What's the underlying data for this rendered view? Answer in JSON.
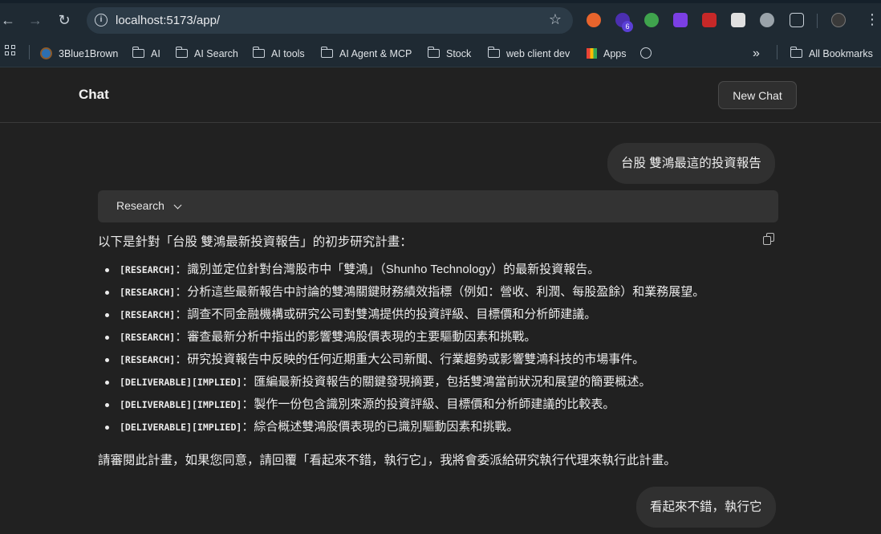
{
  "browser": {
    "url": "localhost:5173/app/",
    "extension_badge": "6",
    "bookmarks": [
      "3Blue1Brown",
      "AI",
      "AI Search",
      "AI tools",
      "AI Agent & MCP",
      "Stock",
      "web client dev",
      "Apps"
    ],
    "all_bookmarks": "All Bookmarks",
    "overflow": "»"
  },
  "app": {
    "title": "Chat",
    "new_chat_label": "New Chat"
  },
  "messages": {
    "user_1": "台股 雙鴻最這的投資報告",
    "research_label": "Research",
    "intro": "以下是針對「台股 雙鴻最新投資報告」的初步研究計畫：",
    "plan": [
      {
        "tag": "[RESEARCH]",
        "text": "：識別並定位針對台灣股市中「雙鴻」（Shunho Technology）的最新投資報告。"
      },
      {
        "tag": "[RESEARCH]",
        "text": "：分析這些最新報告中討論的雙鴻關鍵財務績效指標（例如：營收、利潤、每股盈餘）和業務展望。"
      },
      {
        "tag": "[RESEARCH]",
        "text": "：調查不同金融機構或研究公司對雙鴻提供的投資評級、目標價和分析師建議。"
      },
      {
        "tag": "[RESEARCH]",
        "text": "：審查最新分析中指出的影響雙鴻股價表現的主要驅動因素和挑戰。"
      },
      {
        "tag": "[RESEARCH]",
        "text": "：研究投資報告中反映的任何近期重大公司新聞、行業趨勢或影響雙鴻科技的市場事件。"
      },
      {
        "tag": "[DELIVERABLE][IMPLIED]",
        "text": "：匯編最新投資報告的關鍵發現摘要，包括雙鴻當前狀況和展望的簡要概述。"
      },
      {
        "tag": "[DELIVERABLE][IMPLIED]",
        "text": "：製作一份包含識別來源的投資評級、目標價和分析師建議的比較表。"
      },
      {
        "tag": "[DELIVERABLE][IMPLIED]",
        "text": "：綜合概述雙鴻股價表現的已識別驅動因素和挑戰。"
      }
    ],
    "outro": "請審閱此計畫，如果您同意，請回覆「看起來不錯，執行它」，我將會委派給研究執行代理來執行此計畫。",
    "user_2": "看起來不錯，執行它"
  }
}
